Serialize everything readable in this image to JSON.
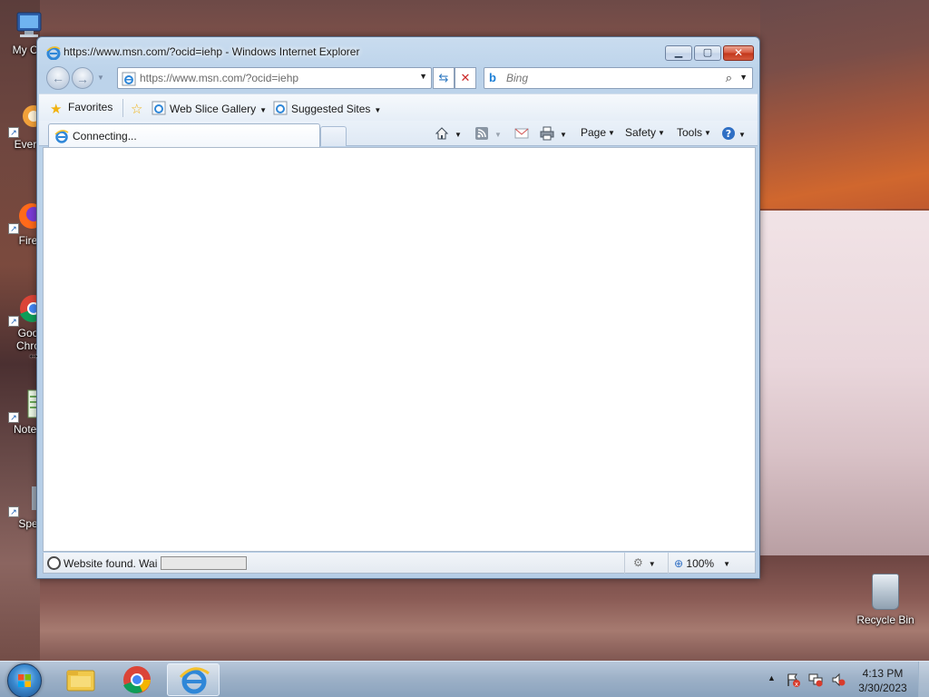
{
  "desktop": {
    "icons": [
      {
        "label": "My Co",
        "kind": "computer-icon"
      },
      {
        "label": "Every",
        "kind": "everything-app-icon"
      },
      {
        "label": "Fire",
        "kind": "firefox-icon"
      },
      {
        "label": "Goo",
        "kind": "chrome-icon"
      },
      {
        "label": "Chro",
        "kind": "chrome-icon"
      },
      {
        "label": "Notep",
        "kind": "notepad-icon"
      },
      {
        "label": "Spe",
        "kind": "app-icon"
      }
    ],
    "recycle_bin": {
      "label": "Recycle Bin"
    }
  },
  "browser": {
    "title": "https://www.msn.com/?ocid=iehp - Windows Internet Explorer",
    "address": "https://www.msn.com/?ocid=iehp",
    "search_placeholder": "Bing",
    "favorites_bar": {
      "favorites_label": "Favorites",
      "web_slice_label": "Web Slice Gallery",
      "suggested_label": "Suggested Sites"
    },
    "tab": {
      "label": "Connecting..."
    },
    "command_bar": {
      "page_label": "Page",
      "safety_label": "Safety",
      "tools_label": "Tools"
    },
    "status": {
      "text": "Website found. Wai",
      "progress": 0.0,
      "zoom": "100%"
    },
    "colors": {
      "close_button": "#c2361a",
      "frame": "#bcd3ea",
      "link_blue": "#1c7fd6"
    }
  },
  "taskbar": {
    "pinned": [
      {
        "name": "windows-explorer-icon"
      },
      {
        "name": "chrome-icon"
      },
      {
        "name": "internet-explorer-icon",
        "active": true
      }
    ],
    "clock": {
      "time": "4:13 PM",
      "date": "3/30/2023"
    }
  }
}
